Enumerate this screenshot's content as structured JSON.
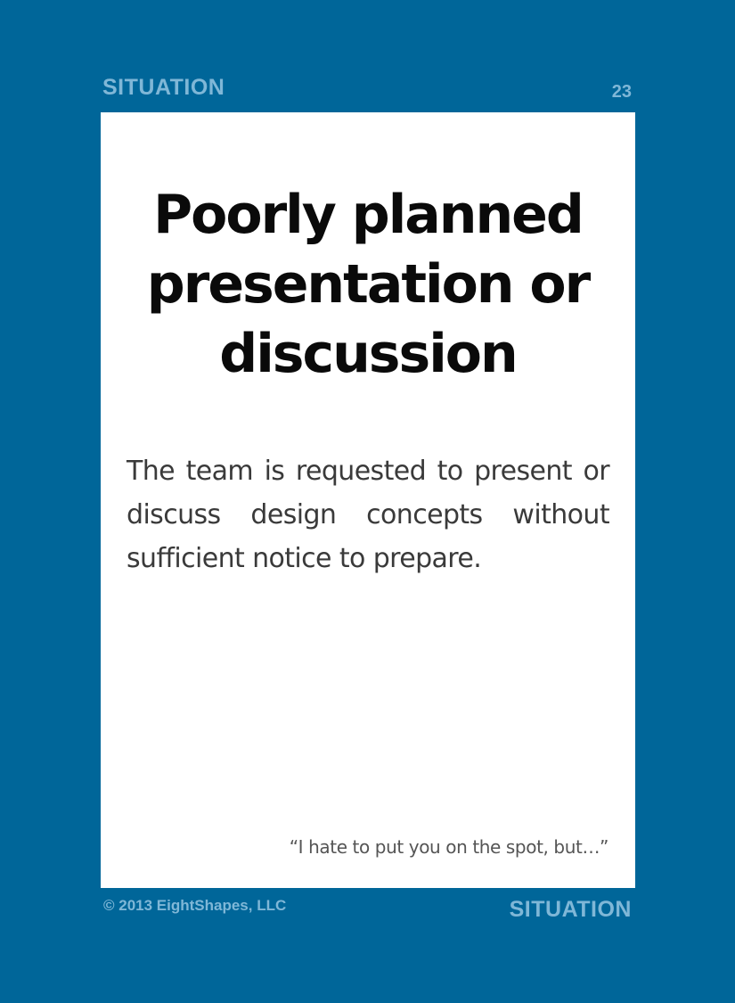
{
  "header": {
    "category": "SITUATION",
    "page_number": "23"
  },
  "card": {
    "title": "Poorly planned presentation or discussion",
    "description": "The team is requested to present or discuss design concepts without sufficient notice to prepare.",
    "quote": "“I hate to put you on the spot, but…”"
  },
  "footer": {
    "copyright": "© 2013 EightShapes, LLC",
    "category": "SITUATION"
  },
  "colors": {
    "background": "#006699",
    "label": "#7fb7d7",
    "card": "#ffffff",
    "title": "#0a0a0a",
    "body_text": "#3a3a3a",
    "quote_text": "#555555"
  }
}
